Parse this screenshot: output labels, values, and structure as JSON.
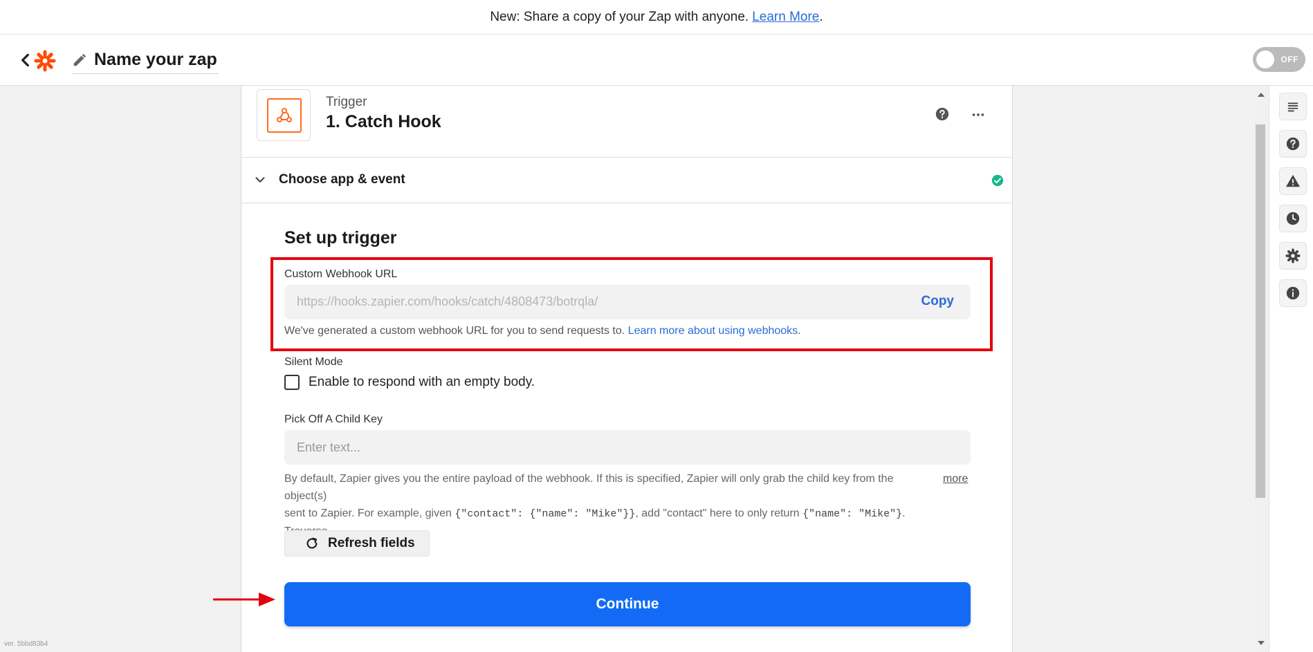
{
  "banner": {
    "text": "New: Share a copy of your Zap with anyone.",
    "link": "Learn More",
    "tail": "."
  },
  "header": {
    "zap_name": "Name your zap",
    "toggle_label": "OFF"
  },
  "step": {
    "subtitle": "Trigger",
    "title": "1. Catch Hook"
  },
  "section": {
    "label": "Choose app & event"
  },
  "setup": {
    "title": "Set up trigger",
    "webhook_label": "Custom Webhook URL",
    "webhook_url": "https://hooks.zapier.com/hooks/catch/4808473/botrqla/",
    "copy_label": "Copy",
    "webhook_hint": "We've generated a custom webhook URL for you to send requests to.",
    "webhook_hint_link": "Learn more about using webhooks",
    "webhook_hint_tail": ".",
    "silent_label": "Silent Mode",
    "silent_checkbox_label": "Enable to respond with an empty body.",
    "child_key_label": "Pick Off A Child Key",
    "child_key_placeholder": "Enter text...",
    "desc_line1": "By default, Zapier gives you the entire payload of the webhook. If this is specified, Zapier will only grab the child key from the object(s)",
    "desc_line2_a": "sent to Zapier. For example, given ",
    "desc_code1": "{\"contact\": {\"name\": \"Mike\"}}",
    "desc_line2_b": ", add \"contact\" here to only return ",
    "desc_code2": "{\"name\": \"Mike\"}",
    "desc_line2_c": ". Traverse...",
    "more_link": "more",
    "refresh_label": "Refresh fields",
    "continue_label": "Continue"
  },
  "version": "ver. 5bbd83b4",
  "colors": {
    "accent": "#136bf5",
    "brand": "#ff4a00",
    "highlight": "#e3000f",
    "success": "#13b88a"
  }
}
